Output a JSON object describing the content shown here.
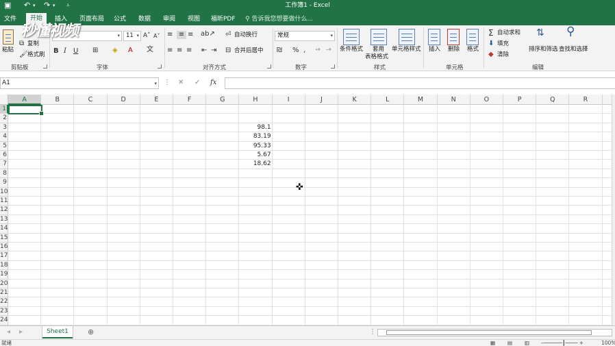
{
  "title_bar": {
    "title": "工作簿1 - Excel",
    "save_icon": "save-icon",
    "undo_icon": "undo-icon",
    "redo_icon": "redo-icon"
  },
  "watermark": "秒懂视频",
  "tabs": [
    "文件",
    "开始",
    "插入",
    "页面布局",
    "公式",
    "数据",
    "审阅",
    "视图",
    "福昕PDF"
  ],
  "tell_me": "告诉我您想要做什么...",
  "ribbon": {
    "clipboard": {
      "paste": "粘贴",
      "copy": "复制",
      "format_painter": "格式刷",
      "label": "剪贴板"
    },
    "font": {
      "size": "11",
      "bold": "B",
      "italic": "I",
      "underline": "U",
      "label": "字体"
    },
    "alignment": {
      "wrap": "自动换行",
      "merge": "合并后居中",
      "label": "对齐方式"
    },
    "number": {
      "format": "常规",
      "percent": "%",
      "comma": ",",
      "label": "数字"
    },
    "styles": {
      "conditional": "条件格式",
      "table_line1": "套用",
      "table_line2": "表格格式",
      "cell_styles": "单元格样式",
      "label": "样式"
    },
    "cells": {
      "insert": "插入",
      "delete": "删除",
      "format": "格式",
      "label": "单元格"
    },
    "editing": {
      "autosum": "自动求和",
      "fill": "填充",
      "clear": "清除",
      "sort": "排序和筛选",
      "find": "查找和选择",
      "label": "编辑"
    }
  },
  "name_box": "A1",
  "fx": "fx",
  "columns": [
    "A",
    "B",
    "C",
    "D",
    "E",
    "F",
    "G",
    "H",
    "I",
    "J",
    "K",
    "L",
    "M",
    "N",
    "O",
    "P",
    "Q",
    "R"
  ],
  "rows": [
    "1",
    "2",
    "3",
    "4",
    "5",
    "6",
    "7",
    "8",
    "9",
    "10",
    "11",
    "12",
    "13",
    "14",
    "15",
    "16",
    "17",
    "18",
    "19",
    "20",
    "21",
    "22",
    "23",
    "24"
  ],
  "cells": {
    "H3": "98.1",
    "H4": "83.19",
    "H5": "95.33",
    "H6": "5.67",
    "H7": "18.62"
  },
  "sheet_tab": "Sheet1",
  "status": {
    "ready": "就绪",
    "zoom": "100%"
  }
}
